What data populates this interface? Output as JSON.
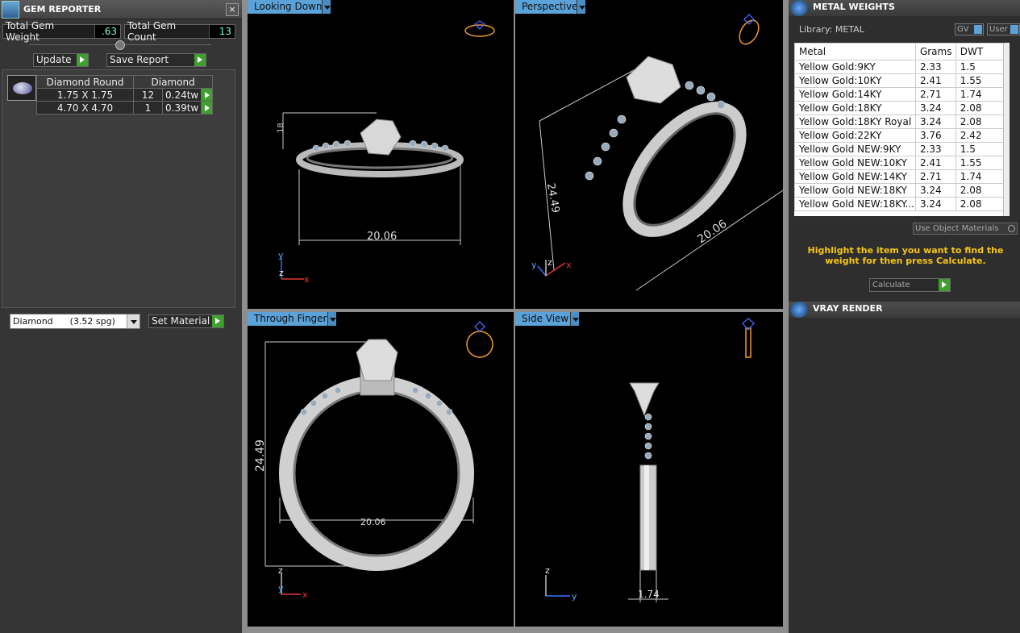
{
  "gem_reporter": {
    "title": "GEM REPORTER",
    "close": "×",
    "total_weight_label": "Total Gem Weight",
    "total_weight_value": ".63",
    "total_count_label": "Total Gem Count",
    "total_count_value": "13",
    "update_label": "Update",
    "save_label": "Save Report",
    "table_header": [
      "Diamond Round",
      "Diamond"
    ],
    "rows": [
      {
        "size": "1.75 X 1.75",
        "count": "12",
        "weight": "0.24tw"
      },
      {
        "size": "4.70 X 4.70",
        "count": "1",
        "weight": "0.39tw"
      }
    ],
    "material_select": "Diamond      (3.52 spg)",
    "set_material_label": "Set Material"
  },
  "viewports": {
    "top_left": {
      "label": "Looking Down",
      "dim_width": "20.06",
      "dim_small": "18"
    },
    "top_right": {
      "label": "Perspective",
      "dim_width": "20.06",
      "dim_height": "24.49"
    },
    "bottom_left": {
      "label": "Through Finger",
      "dim_height": "24.49",
      "dim_width": "20.06"
    },
    "bottom_right": {
      "label": "Side View",
      "dim_width": "1.74"
    },
    "axes": {
      "x": "x",
      "y": "y",
      "z": "z"
    }
  },
  "metal_weights": {
    "title": "METAL WEIGHTS",
    "library": "Library: METAL",
    "gv_label": "GV",
    "user_label": "User",
    "headers": [
      "Metal",
      "Grams",
      "DWT"
    ],
    "rows": [
      [
        "Yellow Gold:9KY",
        "2.33",
        "1.5"
      ],
      [
        "Yellow Gold:10KY",
        "2.41",
        "1.55"
      ],
      [
        "Yellow Gold:14KY",
        "2.71",
        "1.74"
      ],
      [
        "Yellow Gold:18KY",
        "3.24",
        "2.08"
      ],
      [
        "Yellow Gold:18KY Royal",
        "3.24",
        "2.08"
      ],
      [
        "Yellow Gold:22KY",
        "3.76",
        "2.42"
      ],
      [
        "Yellow Gold NEW:9KY",
        "2.33",
        "1.5"
      ],
      [
        "Yellow Gold NEW:10KY",
        "2.41",
        "1.55"
      ],
      [
        "Yellow Gold NEW:14KY",
        "2.71",
        "1.74"
      ],
      [
        "Yellow Gold NEW:18KY",
        "3.24",
        "2.08"
      ],
      [
        "Yellow Gold NEW:18KY...",
        "3.24",
        "2.08"
      ]
    ],
    "use_object_materials": "Use Object Materials",
    "hint": "Highlight the item you want to find the weight for then press Calculate.",
    "calculate_label": "Calculate"
  },
  "vray": {
    "title": "VRAY RENDER"
  }
}
